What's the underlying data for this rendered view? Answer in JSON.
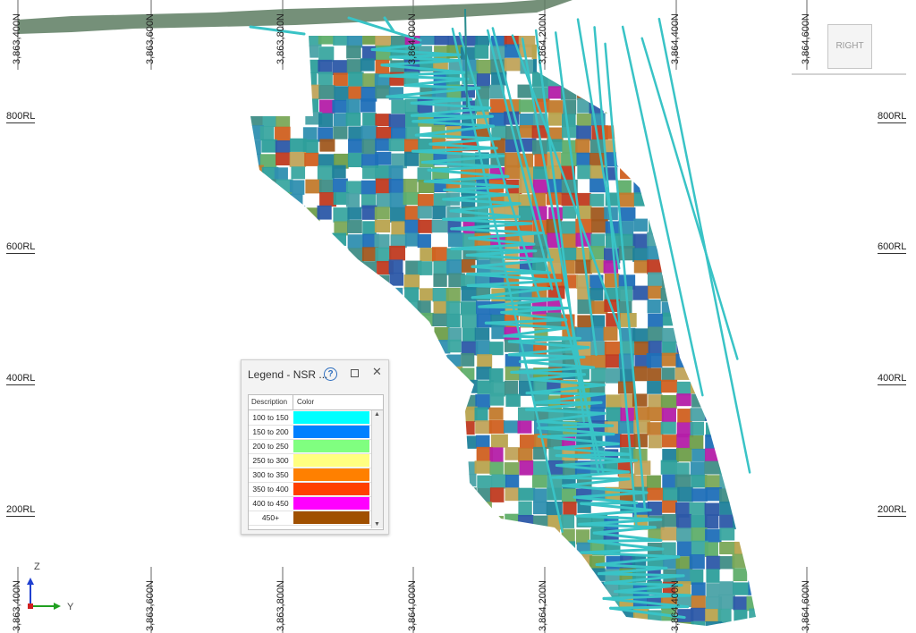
{
  "scene": {
    "northings": [
      "3,863,400N",
      "3,863,600N",
      "3,863,800N",
      "3,864,000N",
      "3,864,200N",
      "3,864,400N",
      "3,864,600N"
    ],
    "reduced_levels": [
      "800RL",
      "600RL",
      "400RL",
      "200RL"
    ],
    "colors": {
      "background": "#ffffff",
      "terrain": "#5d7d62",
      "drill_traces": "#39c3c6"
    }
  },
  "legend": {
    "title": "Legend - NSR ...",
    "help_glyph": "?",
    "close_glyph": "✕",
    "headers": {
      "description": "Description",
      "color": "Color"
    },
    "items": [
      {
        "label": "100 to 150",
        "color": "#00ffff"
      },
      {
        "label": "150 to 200",
        "color": "#0080ff"
      },
      {
        "label": "200 to 250",
        "color": "#80ff80"
      },
      {
        "label": "250 to 300",
        "color": "#ffff80"
      },
      {
        "label": "300 to 350",
        "color": "#ff8000"
      },
      {
        "label": "350 to 400",
        "color": "#ff4000"
      },
      {
        "label": "400 to 450",
        "color": "#ff00ff"
      },
      {
        "label": "450+",
        "color": "#a05000"
      }
    ],
    "scroll_up_glyph": "▲",
    "scroll_down_glyph": "▼"
  },
  "view_cube": {
    "label": "RIGHT"
  },
  "axis_triad": {
    "z_label": "Z",
    "y_label": "Y"
  }
}
